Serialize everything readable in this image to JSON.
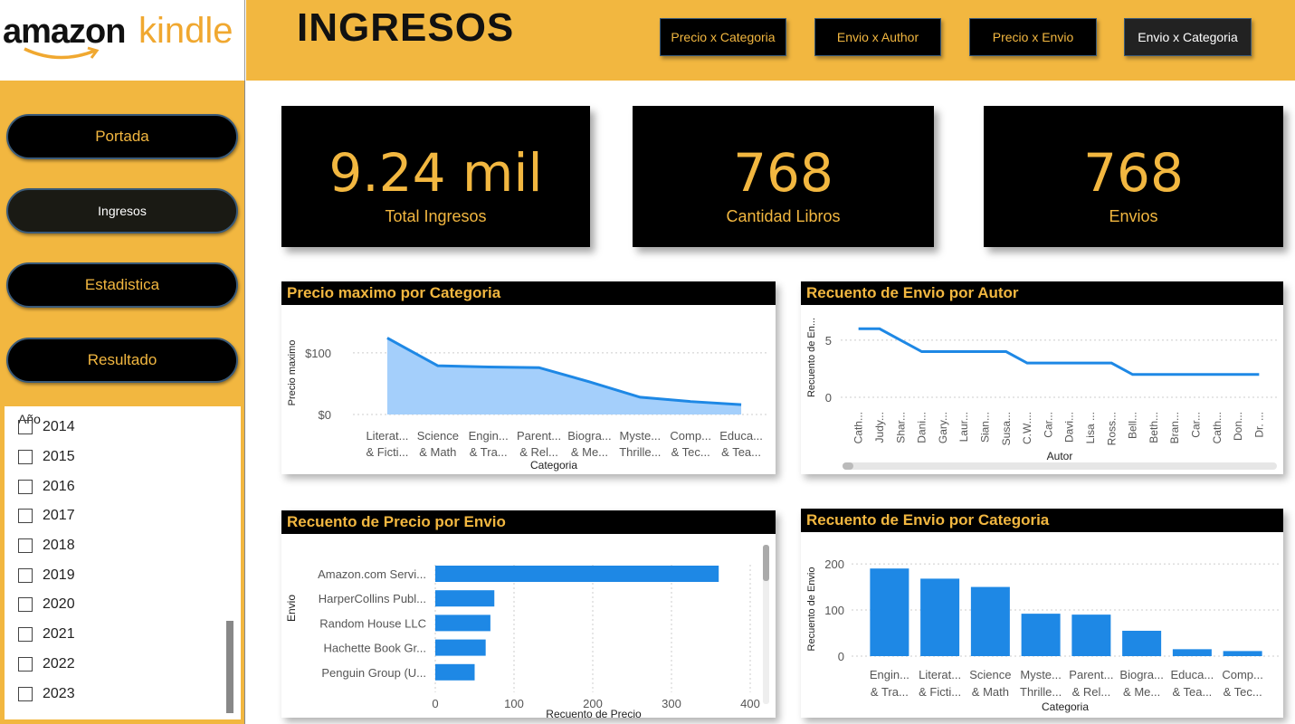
{
  "logo": {
    "part1": "amazon",
    "part2": "kindle"
  },
  "header": {
    "title": "INGRESOS",
    "nav": [
      "Precio x Categoria",
      "Envio x Author",
      "Precio x Envio",
      "Envio x Categoria"
    ]
  },
  "sidebar": {
    "buttons": [
      "Portada",
      "Ingresos",
      "Estadistica",
      "Resultado"
    ],
    "active": "Ingresos",
    "slicer_title": "Año",
    "years": [
      "2014",
      "2015",
      "2016",
      "2017",
      "2018",
      "2019",
      "2020",
      "2021",
      "2022",
      "2023"
    ]
  },
  "kpis": [
    {
      "value": "9.24 mil",
      "label": "Total Ingresos"
    },
    {
      "value": "768",
      "label": "Cantidad Libros"
    },
    {
      "value": "768",
      "label": "Envios"
    }
  ],
  "colors": {
    "accent": "#f2b740",
    "series": "#1e88e5",
    "area": "#a4cffb"
  },
  "chart_data": [
    {
      "type": "area",
      "title": "Precio maximo por Categoria",
      "xlabel": "Categoria",
      "ylabel": "Precio maximo",
      "categories": [
        [
          "Literat...",
          "& Ficti..."
        ],
        [
          "Science",
          "& Math"
        ],
        [
          "Engin...",
          "& Tra..."
        ],
        [
          "Parent...",
          "& Rel..."
        ],
        [
          "Biogra...",
          "& Me..."
        ],
        [
          "Myste...",
          "Thrille..."
        ],
        [
          "Comp...",
          "& Tec..."
        ],
        [
          "Educa...",
          "& Tea..."
        ]
      ],
      "values": [
        124,
        79,
        77,
        76,
        53,
        28,
        21,
        16
      ],
      "yticks": [
        {
          "v": 0,
          "t": "$0"
        },
        {
          "v": 100,
          "t": "$100"
        }
      ],
      "ylim": [
        0,
        135
      ]
    },
    {
      "type": "line",
      "title": "Recuento de Envio por Autor",
      "xlabel": "Autor",
      "ylabel": "Recuento de En...",
      "categories": [
        "Cath...",
        "Judy...",
        "Shar...",
        "Dani...",
        "Gary...",
        "Laur...",
        "Sian...",
        "Susa...",
        "C.W....",
        "Car...",
        "Davi...",
        "Lisa ...",
        "Ross...",
        "Bell...",
        "Beth...",
        "Bran...",
        "Car...",
        "Cath...",
        "Don...",
        "Dr. ..."
      ],
      "values": [
        6,
        6,
        5,
        4,
        4,
        4,
        4,
        4,
        3,
        3,
        3,
        3,
        3,
        2,
        2,
        2,
        2,
        2,
        2,
        2
      ],
      "yticks": [
        {
          "v": 0,
          "t": "0"
        },
        {
          "v": 5,
          "t": "5"
        }
      ],
      "ylim": [
        0,
        6.5
      ]
    },
    {
      "type": "bar",
      "orientation": "horizontal",
      "title": "Recuento de Precio por Envio",
      "xlabel": "Recuento de Precio",
      "ylabel": "Envio",
      "categories": [
        "Amazon.com Servi...",
        "HarperCollins Publ...",
        "Random House LLC",
        "Hachette Book Gr...",
        "Penguin Group (U..."
      ],
      "values": [
        360,
        75,
        70,
        64,
        50
      ],
      "xticks": [
        {
          "v": 0,
          "t": "0"
        },
        {
          "v": 100,
          "t": "100"
        },
        {
          "v": 200,
          "t": "200"
        },
        {
          "v": 300,
          "t": "300"
        },
        {
          "v": 400,
          "t": "400"
        }
      ],
      "xlim": [
        0,
        400
      ]
    },
    {
      "type": "bar",
      "title": "Recuento de Envio por Categoria",
      "xlabel": "Categoria",
      "ylabel": "Recuento de Envio",
      "categories": [
        [
          "Engin...",
          "& Tra..."
        ],
        [
          "Literat...",
          "& Ficti..."
        ],
        [
          "Science",
          "& Math"
        ],
        [
          "Myste...",
          "Thrille..."
        ],
        [
          "Parent...",
          "& Rel..."
        ],
        [
          "Biogra...",
          "& Me..."
        ],
        [
          "Educa...",
          "& Tea..."
        ],
        [
          "Comp...",
          "& Tec..."
        ]
      ],
      "values": [
        190,
        168,
        150,
        92,
        90,
        55,
        15,
        11
      ],
      "yticks": [
        {
          "v": 0,
          "t": "0"
        },
        {
          "v": 100,
          "t": "100"
        },
        {
          "v": 200,
          "t": "200"
        }
      ],
      "ylim": [
        0,
        210
      ]
    }
  ]
}
